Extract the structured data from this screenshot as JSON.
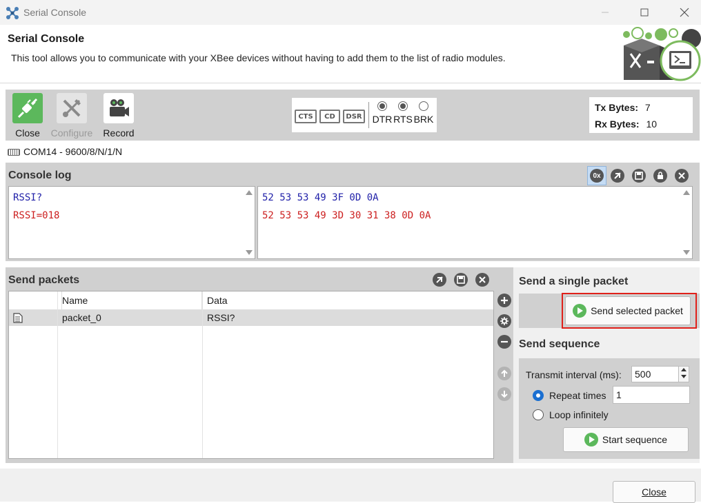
{
  "window": {
    "title": "Serial Console"
  },
  "header": {
    "title": "Serial Console",
    "description": "This tool allows you to communicate with your XBee devices without having to add them to the list of radio modules."
  },
  "toolbar": {
    "close_label": "Close",
    "configure_label": "Configure",
    "record_label": "Record",
    "line_indicators": [
      "CTS",
      "CD",
      "DSR"
    ],
    "control_lines": [
      {
        "label": "DTR",
        "checked": true
      },
      {
        "label": "RTS",
        "checked": true
      },
      {
        "label": "BRK",
        "checked": false
      }
    ],
    "tx_label": "Tx Bytes:",
    "tx_value": "7",
    "rx_label": "Rx Bytes:",
    "rx_value": "10"
  },
  "port": {
    "text": "COM14 - 9600/8/N/1/N"
  },
  "console": {
    "title": "Console log",
    "hex_toggle": "0x",
    "ascii_lines": [
      "RSSI?",
      "RSSI=018"
    ],
    "hex_lines": [
      "52 53 53 49 3F 0D 0A",
      "52 53 53 49 3D 30 31 38 0D 0A"
    ]
  },
  "packets": {
    "title": "Send packets",
    "columns": [
      "",
      "Name",
      "Data"
    ],
    "rows": [
      {
        "name": "packet_0",
        "data": "RSSI?"
      }
    ]
  },
  "single": {
    "title": "Send a single packet",
    "send_button": "Send selected packet"
  },
  "sequence": {
    "title": "Send sequence",
    "interval_label": "Transmit interval (ms):",
    "interval_value": "500",
    "repeat_label": "Repeat times",
    "repeat_value": "1",
    "loop_label": "Loop infinitely",
    "start_button": "Start sequence"
  },
  "footer": {
    "close_button": "Close"
  },
  "colors": {
    "accent_green": "#5cb85c",
    "highlight_red": "#e0201a",
    "hex_blue": "#1f1fa8",
    "hex_red": "#cc1f1f"
  }
}
